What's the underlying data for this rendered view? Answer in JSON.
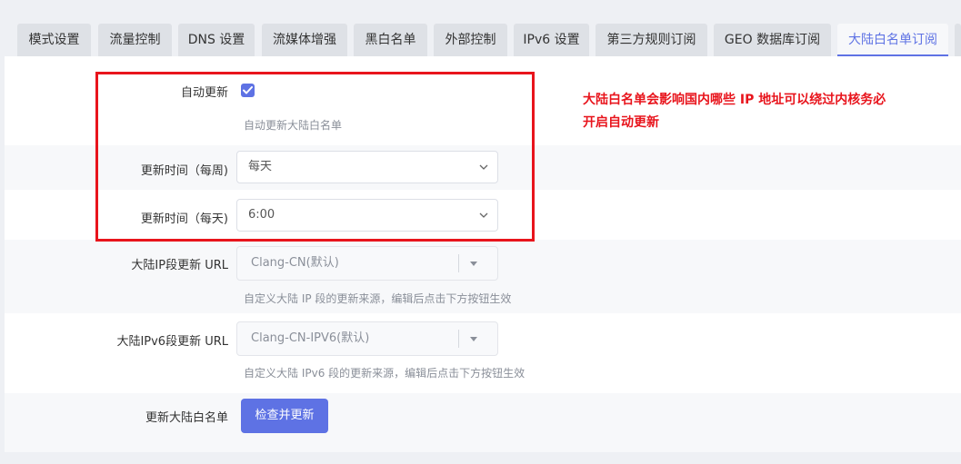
{
  "tabs": [
    {
      "label": "模式设置"
    },
    {
      "label": "流量控制"
    },
    {
      "label": "DNS 设置"
    },
    {
      "label": "流媒体增强"
    },
    {
      "label": "黑白名单"
    },
    {
      "label": "外部控制"
    },
    {
      "label": "IPv6 设置"
    },
    {
      "label": "第三方规则订阅"
    },
    {
      "label": "GEO 数据库订阅"
    },
    {
      "label": "大陆白名单订阅",
      "active": true
    }
  ],
  "form": {
    "auto_update": {
      "label": "自动更新",
      "checked": true,
      "description": "自动更新大陆白名单"
    },
    "weekly_time": {
      "label": "更新时间（每周)",
      "value": "每天"
    },
    "daily_time": {
      "label": "更新时间（每天)",
      "value": "6:00"
    },
    "ip_url": {
      "label": "大陆IP段更新 URL",
      "value": "Clang-CN(默认)",
      "description": "自定义大陆 IP 段的更新来源，编辑后点击下方按钮生效"
    },
    "ipv6_url": {
      "label": "大陆IPv6段更新 URL",
      "value": "Clang-CN-IPV6(默认)",
      "description": "自定义大陆 IPv6 段的更新来源，编辑后点击下方按钮生效"
    },
    "update_whitelist": {
      "label": "更新大陆白名单",
      "button": "检查并更新"
    }
  },
  "annotation": {
    "text": "大陆白名单会影响国内哪些 IP 地址可以绕过内核务必开启自动更新"
  },
  "colors": {
    "accent": "#5e72e4",
    "annotation_red": "#e8141c"
  }
}
